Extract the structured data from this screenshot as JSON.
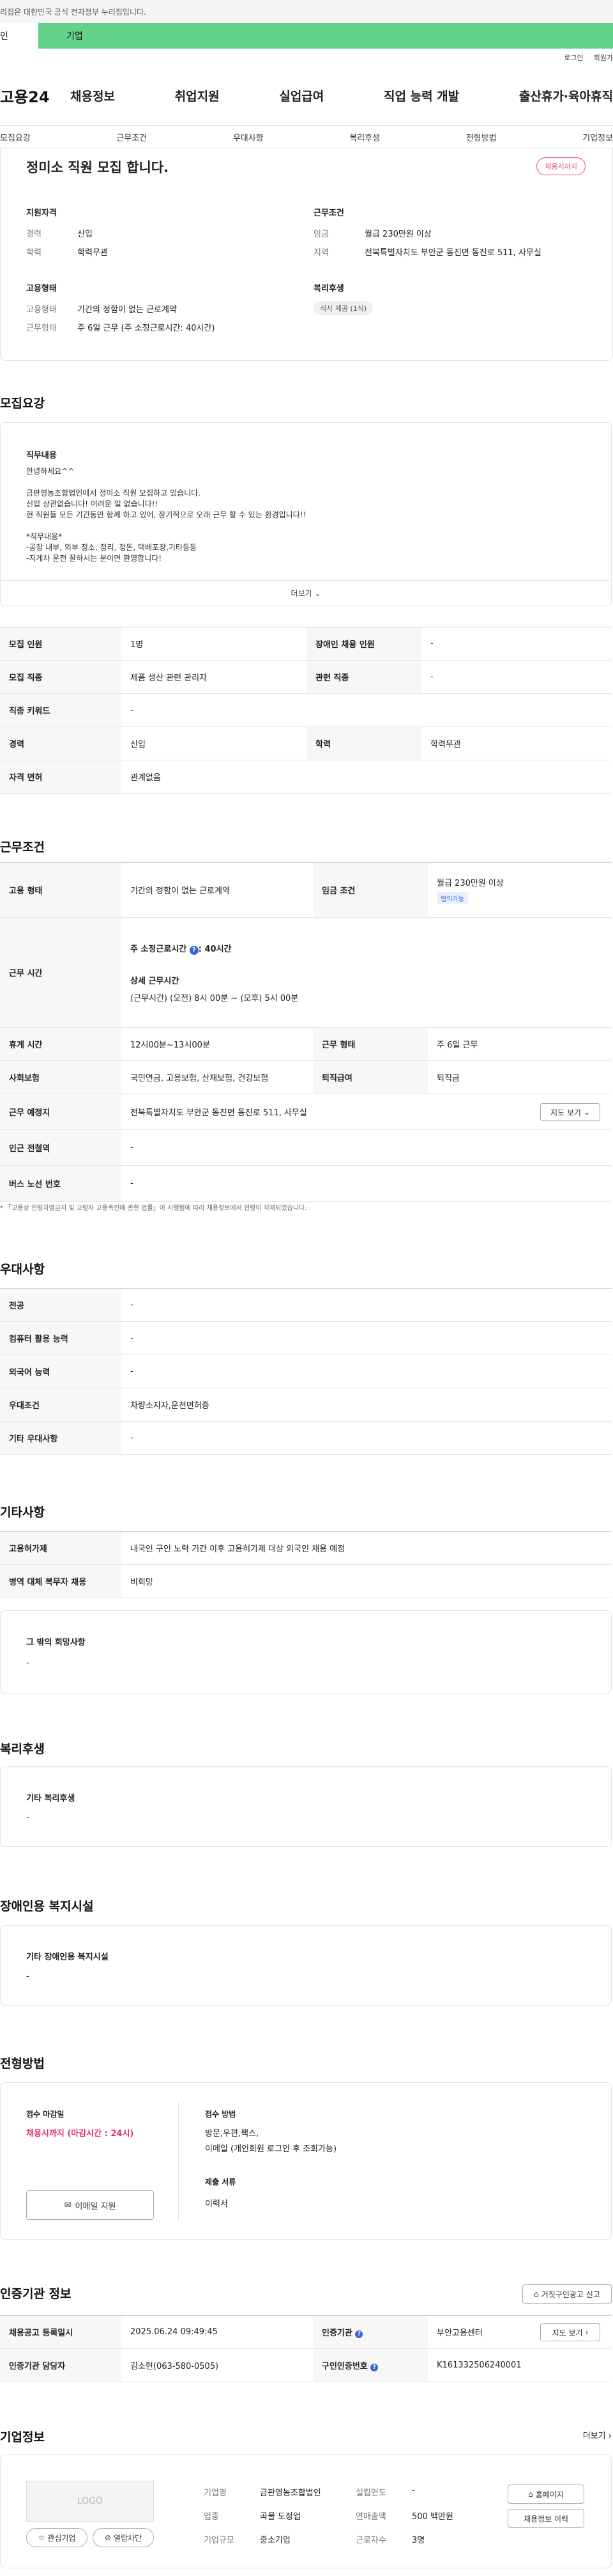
{
  "notice": {
    "text": "리집은 대한민국 공식 전자정부 누리집입니다."
  },
  "gnb": {
    "tab1": "인",
    "tab2": "기업"
  },
  "util": {
    "login": "로그인",
    "join": "회원가"
  },
  "header": {
    "logo": "고용24",
    "menu": [
      "채용정보",
      "취업지원",
      "실업급여",
      "직업 능력 개발",
      "출산휴가·육아휴직"
    ]
  },
  "tabs": [
    "모집요강",
    "근무조건",
    "우대사항",
    "복리후생",
    "전형방법",
    "기업정보"
  ],
  "summary": {
    "title": "정미소 직원 모집 합니다.",
    "badge": "채용시까지",
    "qual_head": "지원자격",
    "career_label": "경력",
    "career": "신입",
    "edu_label": "학력",
    "edu": "학력무관",
    "cond_head": "근무조건",
    "wage_label": "임금",
    "wage": "월급 230만원 이상",
    "region_label": "지역",
    "region": "전북특별자치도 부안군 동진면 동진로 511, 사무실",
    "emp_head": "고용형태",
    "emp_label": "고용형태",
    "emp": "기간의 정함이 없는 근로계약",
    "worktype_label": "근무형태",
    "worktype": "주 6일 근무 (주 소정근로시간: 40시간)",
    "welfare_head": "복리후생",
    "welfare_chip": "식사 제공 (1식)"
  },
  "recruit": {
    "title": "모집요강",
    "job_head": "직무내용",
    "lines": [
      "안녕하세요^^",
      "",
      "금판영농조합법인에서 정미소 직원 모집하고 있습니다.",
      "신입 상관없습니다! 어려운 일 없습니다!!",
      "현 직원들 모든 기간동안 함께 하고 있어, 장기적으로 오래 근무 할 수 있는 환경입니다!!",
      "",
      "*직무내용*",
      "-공장 내부, 외부 청소, 정리, 정돈, 택배포장,기타등등",
      "-지게차 운전 잘하시는 분이면 환영합니다!"
    ],
    "more": "더보기",
    "rows": [
      {
        "l1": "모집 인원",
        "v1": "1명",
        "l2": "장애인 채용 인원",
        "v2": "-"
      },
      {
        "l1": "모집 직종",
        "v1": "제품 생산 관련 관리자",
        "l2": "관련 직종",
        "v2": "-"
      },
      {
        "l1": "직종 키워드",
        "v1": "-"
      },
      {
        "l1": "경력",
        "v1": "신입",
        "l2": "학력",
        "v2": "학력무관"
      },
      {
        "l1": "자격 면허",
        "v1": "관계없음"
      }
    ]
  },
  "work": {
    "title": "근무조건",
    "emp_label": "고용 형태",
    "emp": "기간의 정함이 없는 근로계약",
    "wage_label": "임금 조건",
    "wage": "월급 230만원 이상",
    "wage_chip": "협의가능",
    "hours_label": "근무 시간",
    "hours_main": "주 소정근로시간",
    "hours_val": ": 40시간",
    "hours_detail_head": "상세 근무시간",
    "hours_detail": "(근무시간) (오전) 8시 00분 ~ (오후) 5시 00분",
    "rest_label": "휴게 시간",
    "rest": "12시00분~13시00분",
    "form_label": "근무 형태",
    "form": "주 6일 근무",
    "ins_label": "사회보험",
    "ins": "국민연금, 고용보험, 산재보험, 건강보험",
    "ret_label": "퇴직급여",
    "ret": "퇴직금",
    "place_label": "근무 예정지",
    "place": "전북특별자치도 부안군 동진면 동진로 511, 사무실",
    "map_btn": "지도 보기",
    "sub_label": "인근 전철역",
    "sub": "-",
    "bus_label": "버스 노선 번호",
    "bus": "-",
    "footnote": "* 「고용상 연령차별금지 및 고령자 고용촉진에 관한 법률」이 시행됨에 따라 채용정보에서 연령이 삭제되었습니다."
  },
  "pref": {
    "title": "우대사항",
    "rows": [
      {
        "l": "전공",
        "v": "-"
      },
      {
        "l": "컴퓨터 활용 능력",
        "v": "-"
      },
      {
        "l": "외국어 능력",
        "v": "-"
      },
      {
        "l": "우대조건",
        "v": "차량소지자,운전면허증"
      },
      {
        "l": "기타 우대사항",
        "v": "-"
      }
    ]
  },
  "etc": {
    "title": "기타사항",
    "rows": [
      {
        "l": "고용허가제",
        "v": "내국인 구인 노력 기간 이후 고용허가제 대상 외국인 채용 예정"
      },
      {
        "l": "병역 대체 복무자 채용",
        "v": "비희망"
      }
    ],
    "other_head": "그 밖의 희망사항",
    "other_val": "-"
  },
  "benefit": {
    "title": "복리후생",
    "head": "기타 복리후생",
    "val": "-"
  },
  "disabled": {
    "title": "장애인용 복지시설",
    "head": "기타 장애인용 복지시설",
    "val": "-"
  },
  "process": {
    "title": "전형방법",
    "deadline_head": "접수 마감일",
    "deadline": "채용시까지 (마감시간 : 24시)",
    "email_btn": "이메일 지원",
    "method_head": "접수 방법",
    "method1": "방문,우편,팩스,",
    "method2": "이메일 (개인회원 로그인 후 조회가능)",
    "docs_head": "제출 서류",
    "docs": "이력서"
  },
  "agency": {
    "title": "인증기관 정보",
    "report_btn": "거짓구인광고 신고",
    "reg_label": "채용공고 등록일시",
    "reg": "2025.06.24 09:49:45",
    "org_label": "인증기관",
    "org": "부안고용센터",
    "map_btn": "지도 보기",
    "mgr_label": "인증기관 담당자",
    "mgr": "김소현(063-580-0505)",
    "no_label": "구인인증번호",
    "no": "K161332506240001"
  },
  "company": {
    "title": "기업정보",
    "more": "더보기",
    "logo": "LOGO",
    "fav_btn": "관심기업",
    "wish_btn": "열람차단",
    "name_label": "기업명",
    "name": "금판영농조합법인",
    "ind_label": "업종",
    "ind": "곡물 도정업",
    "size_label": "기업규모",
    "size": "중소기업",
    "year_label": "설립연도",
    "year": "-",
    "sales_label": "연매출액",
    "sales": "500 백만원",
    "emp_label": "근로자수",
    "emp": "3명",
    "home_btn": "홈페이지",
    "jobs_btn": "채용정보 이력"
  }
}
